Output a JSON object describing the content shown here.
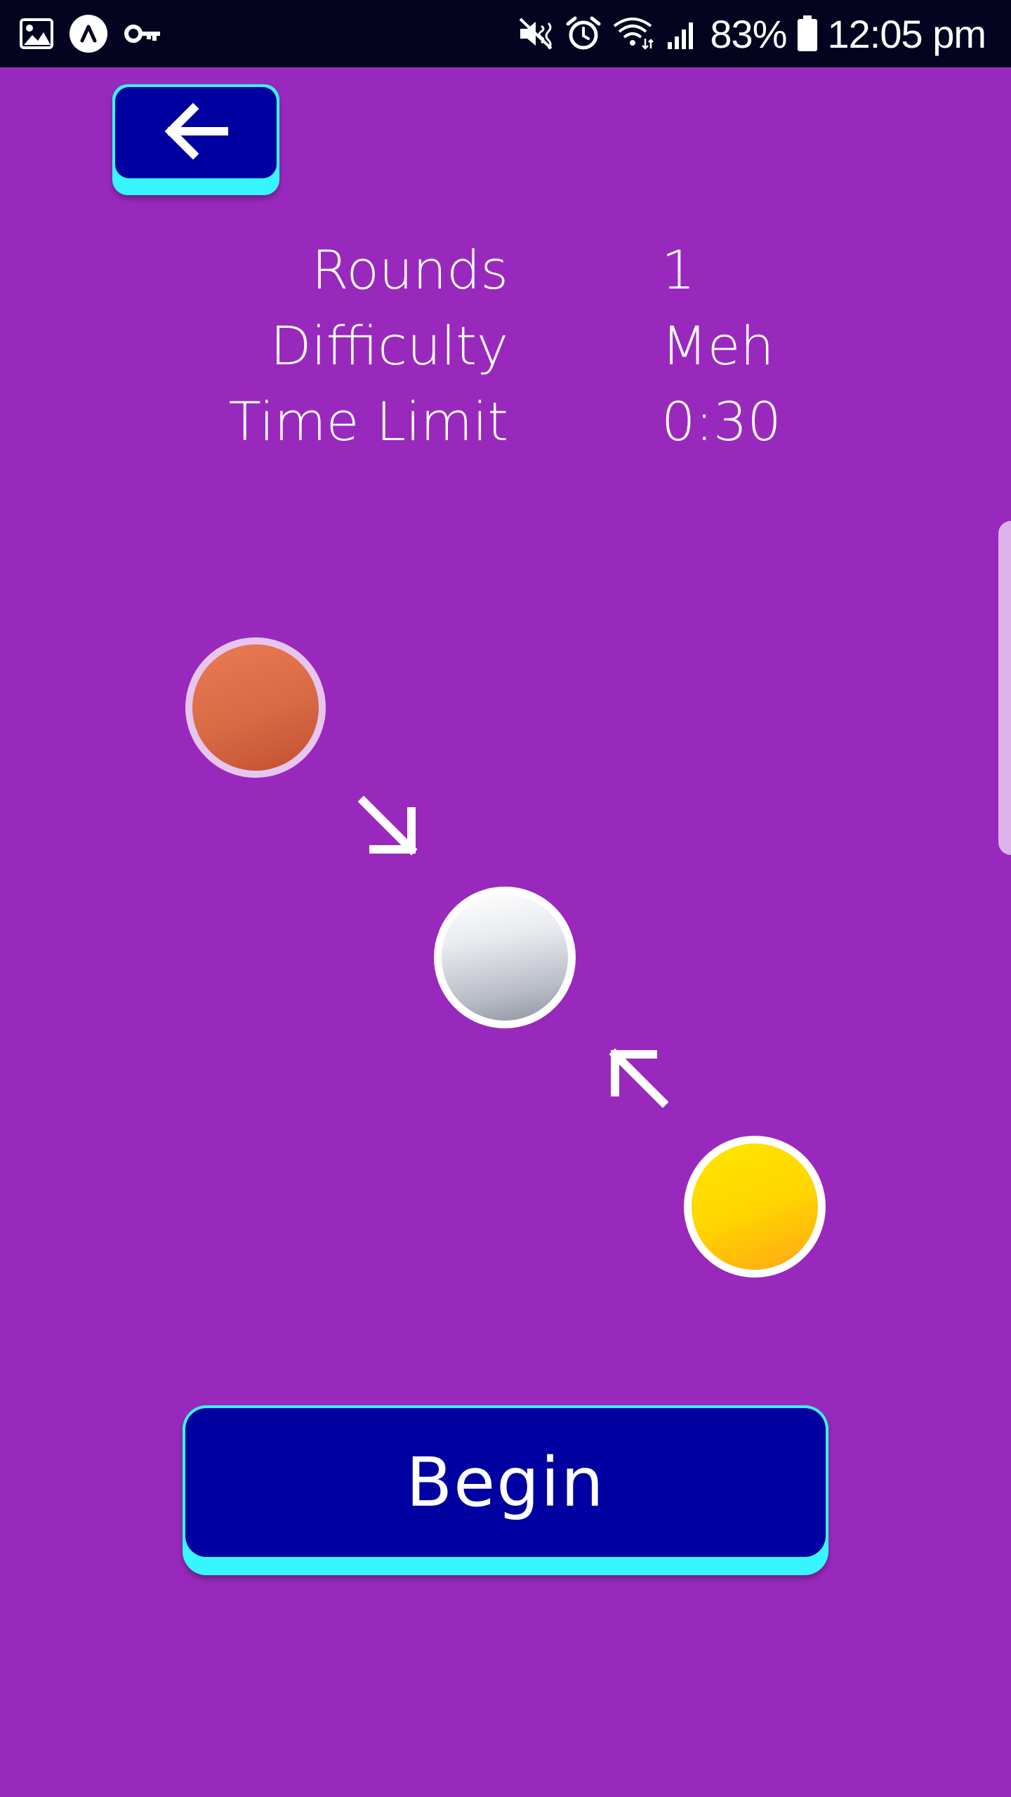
{
  "status_bar": {
    "battery": "83%",
    "time": "12:05 pm",
    "left_icons": [
      "image-icon",
      "app-circle-icon",
      "key-icon"
    ],
    "right_icons": [
      "mute-icon",
      "alarm-icon",
      "wifi-icon",
      "signal-icon",
      "battery-icon"
    ]
  },
  "back_button": {
    "icon": "arrow-left-icon"
  },
  "settings": [
    {
      "label": "Rounds",
      "value": "1"
    },
    {
      "label": "Difficulty",
      "value": "Meh"
    },
    {
      "label": "Time Limit",
      "value": "0:30"
    }
  ],
  "sequence": {
    "balls": [
      "orange",
      "white",
      "yellow"
    ],
    "arrows": [
      "arrow-down-right-icon",
      "arrow-up-left-icon"
    ]
  },
  "colors": {
    "background": "#9929bd",
    "button_face": "#0000a0",
    "button_edge": "#37f6ff",
    "status_bar": "#040420"
  },
  "begin_button": {
    "label": "Begin"
  }
}
